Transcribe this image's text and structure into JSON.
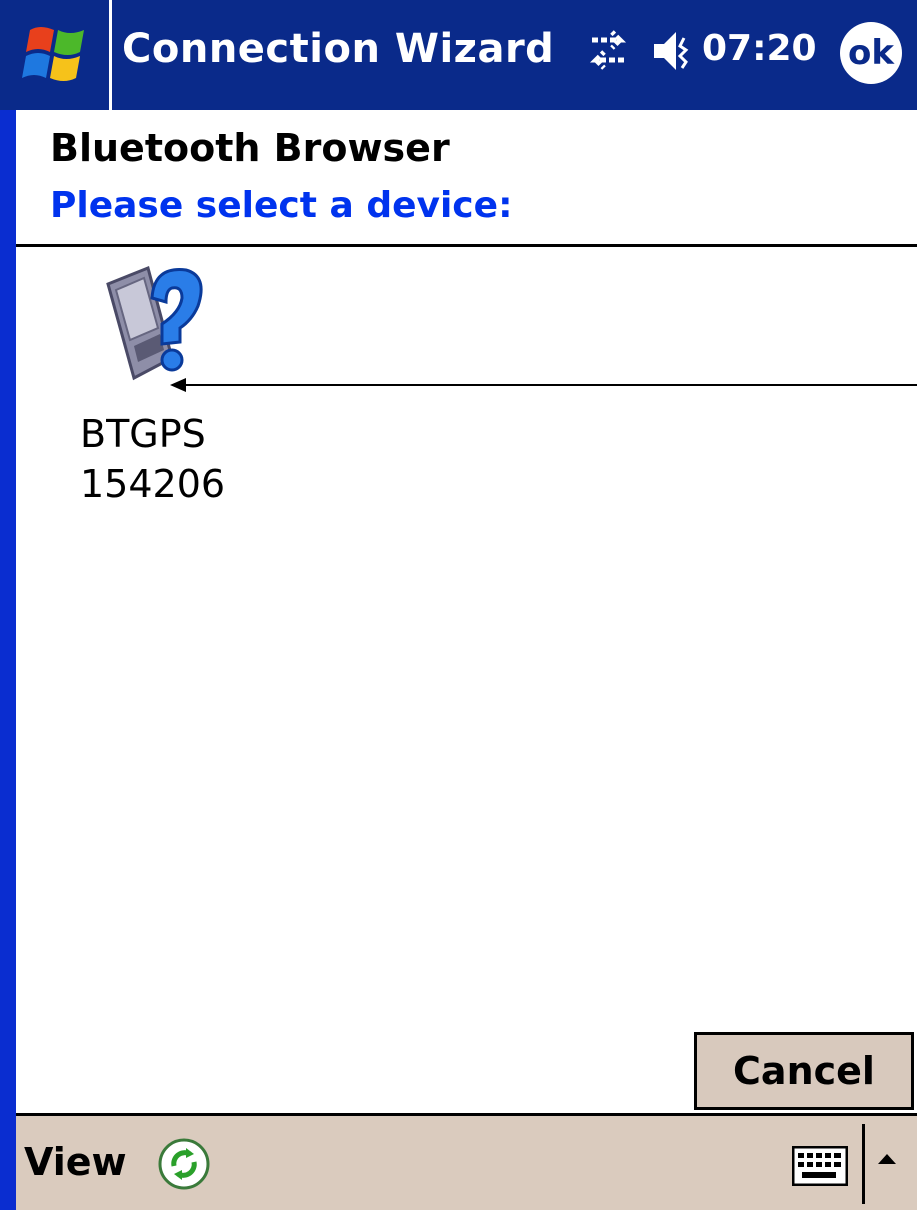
{
  "titlebar": {
    "app_title": "Connection Wizard",
    "clock": "07:20",
    "ok_label": "ok",
    "start_icon": "windows-flag-icon",
    "connectivity_icon": "connectivity-arrows-icon",
    "volume_icon": "speaker-icon"
  },
  "header": {
    "title": "Bluetooth Browser",
    "subtitle": "Please select a device:"
  },
  "devices": [
    {
      "name": "BTGPS",
      "id": "154206",
      "icon": "unknown-device-icon"
    }
  ],
  "buttons": {
    "cancel_label": "Cancel"
  },
  "menubar": {
    "view_label": "View",
    "refresh_icon": "refresh-icon",
    "keyboard_icon": "keyboard-icon",
    "input_arrow_icon": "up-arrow-icon"
  },
  "colors": {
    "titlebar": "#0a2a8a",
    "accent_text": "#0033ee",
    "menubar": "#dacbbe"
  }
}
